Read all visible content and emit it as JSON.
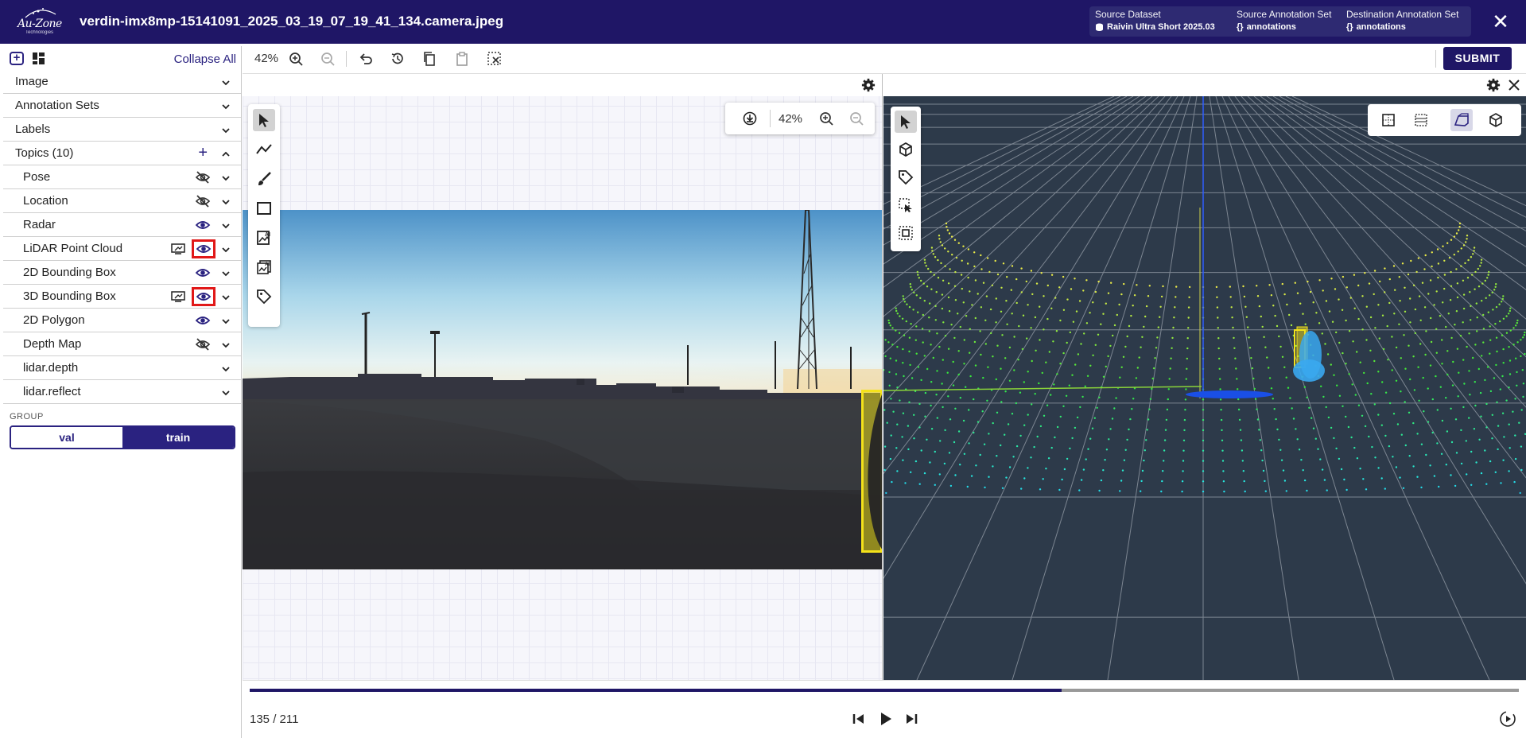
{
  "header": {
    "logo_text": "Au-Zone",
    "logo_sub": "Technologies",
    "file_title": "verdin-imx8mp-15141091_2025_03_19_07_19_41_134.camera.jpeg",
    "source_dataset_label": "Source Dataset",
    "source_dataset_value": "Raivin Ultra Short 2025.03",
    "source_annotation_label": "Source Annotation Set",
    "source_annotation_value": "annotations",
    "destination_annotation_label": "Destination Annotation Set",
    "destination_annotation_value": "annotations",
    "json_glyph": "{}"
  },
  "sidebar": {
    "collapse_all": "Collapse All",
    "sections": [
      {
        "label": "Image"
      },
      {
        "label": "Annotation Sets"
      },
      {
        "label": "Labels"
      },
      {
        "label": "Topics (10)"
      }
    ],
    "topics": [
      {
        "label": "Pose",
        "visible": false
      },
      {
        "label": "Location",
        "visible": false
      },
      {
        "label": "Radar",
        "visible": true
      },
      {
        "label": "LiDAR Point Cloud",
        "visible": true
      },
      {
        "label": "2D Bounding Box",
        "visible": true
      },
      {
        "label": "3D Bounding Box",
        "visible": true
      },
      {
        "label": "2D Polygon",
        "visible": true
      },
      {
        "label": "Depth Map",
        "visible": false
      },
      {
        "label": "lidar.depth"
      },
      {
        "label": "lidar.reflect"
      }
    ],
    "group_label": "GROUP",
    "group_options": [
      "val",
      "train"
    ],
    "group_selected": "train"
  },
  "toolbar": {
    "zoom": "42%",
    "submit_label": "SUBMIT"
  },
  "image_view": {
    "zoom": "42%"
  },
  "player": {
    "frame_text": "135 / 211",
    "current_frame": 135,
    "total_frames": 211
  },
  "colors": {
    "brand": "#1f1666",
    "highlight": "#e11818",
    "bbox": "#f4e21a",
    "cloud_bg": "#2d3a4a"
  }
}
